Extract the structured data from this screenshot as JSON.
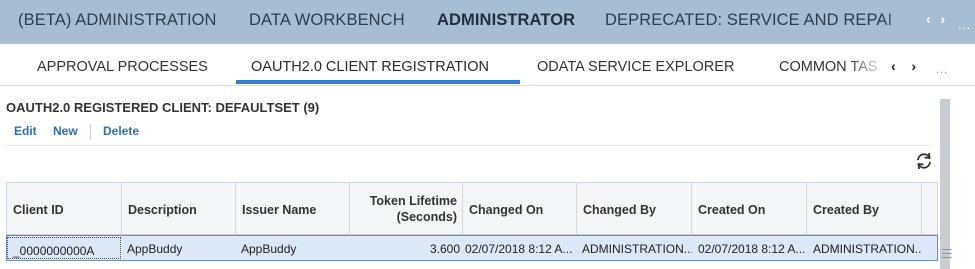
{
  "workcenters": {
    "tabs": [
      {
        "label": "(BETA) ADMINISTRATION"
      },
      {
        "label": "DATA WORKBENCH"
      },
      {
        "label": "ADMINISTRATOR"
      },
      {
        "label": "DEPRECATED: SERVICE AND REPAI"
      }
    ],
    "active_tab": "ADMINISTRATOR",
    "nav_arrows": "‹ ›",
    "more": "..."
  },
  "views": {
    "tabs": [
      {
        "label": "APPROVAL PROCESSES"
      },
      {
        "label": "OAUTH2.0 CLIENT REGISTRATION"
      },
      {
        "label": "ODATA SERVICE EXPLORER"
      },
      {
        "label": "COMMON TAS"
      }
    ],
    "active_tab": "OAUTH2.0 CLIENT REGISTRATION",
    "nav_arrows": "‹ ›",
    "more": "..."
  },
  "list": {
    "title": "OAUTH2.0 REGISTERED CLIENT: DEFAULTSET (9)",
    "actions": {
      "edit": "Edit",
      "new": "New",
      "delete": "Delete"
    },
    "columns": [
      {
        "label": "Client ID"
      },
      {
        "label": "Description"
      },
      {
        "label": "Issuer Name"
      },
      {
        "label": "Token Lifetime (Seconds)",
        "line1": "Token Lifetime",
        "line2": "(Seconds)"
      },
      {
        "label": "Changed On"
      },
      {
        "label": "Changed By"
      },
      {
        "label": "Created On"
      },
      {
        "label": "Created By"
      }
    ],
    "rows": [
      {
        "client_id": "_0000000000A",
        "description": "AppBuddy",
        "issuer_name": "AppBuddy",
        "token_lifetime": "3.600",
        "changed_on": "02/07/2018 8:12 A...",
        "changed_by": "ADMINISTRATION...",
        "created_on": "02/07/2018 8:12 A...",
        "created_by": "ADMINISTRATION.."
      }
    ]
  },
  "colors": {
    "header_bg": "#a9bdd2",
    "accent": "#2f80d1",
    "link": "#2a6fb5",
    "selected_row": "#dce8f6"
  }
}
